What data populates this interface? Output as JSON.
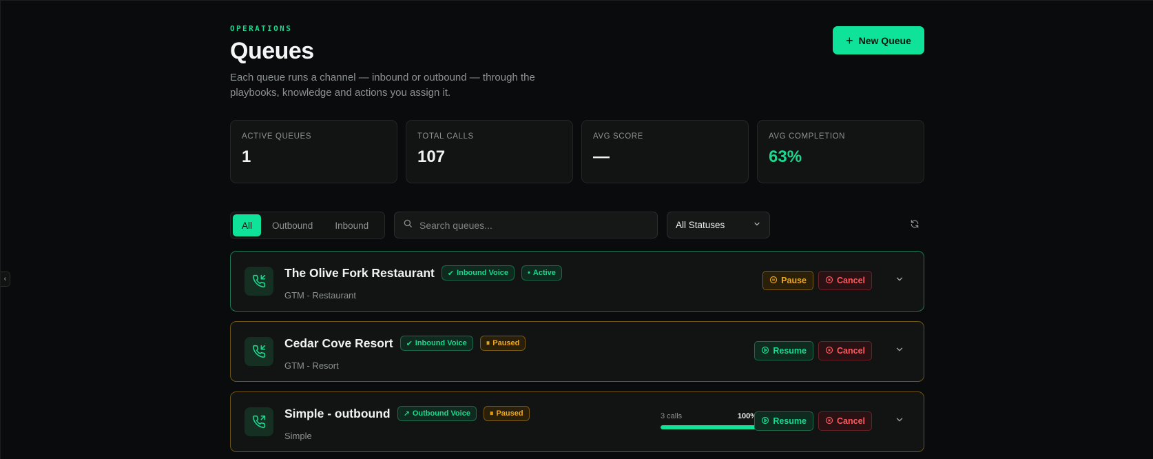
{
  "header": {
    "eyebrow": "OPERATIONS",
    "title": "Queues",
    "subtitle": "Each queue runs a channel — inbound or outbound — through the playbooks, knowledge and actions you assign it.",
    "new_queue_label": "New Queue"
  },
  "stats": [
    {
      "label": "ACTIVE QUEUES",
      "value": "1"
    },
    {
      "label": "TOTAL CALLS",
      "value": "107"
    },
    {
      "label": "AVG SCORE",
      "value": "—"
    },
    {
      "label": "AVG COMPLETION",
      "value": "63%"
    }
  ],
  "filters": {
    "tabs": [
      "All",
      "Outbound",
      "Inbound"
    ],
    "active_tab": "All",
    "search_placeholder": "Search queues...",
    "status_select": "All Statuses"
  },
  "queues": [
    {
      "name": "The Olive Fork Restaurant",
      "channel": "Inbound Voice",
      "status": "Active",
      "subtitle": "GTM - Restaurant",
      "primary_action": "Pause",
      "cancel_label": "Cancel"
    },
    {
      "name": "Cedar Cove Resort",
      "channel": "Inbound Voice",
      "status": "Paused",
      "subtitle": "GTM - Resort",
      "primary_action": "Resume",
      "cancel_label": "Cancel"
    },
    {
      "name": "Simple - outbound",
      "channel": "Outbound Voice",
      "status": "Paused",
      "subtitle": "Simple",
      "progress_calls": "3 calls",
      "progress_percent": "100%",
      "progress_fraction": 1.0,
      "primary_action": "Resume",
      "cancel_label": "Cancel"
    }
  ],
  "colors": {
    "accent": "#0fe39a",
    "accent_text": "#19d98f",
    "paused": "#f0a81e",
    "danger": "#ff5a5f",
    "background": "#0a0b0c",
    "card": "#121414"
  }
}
